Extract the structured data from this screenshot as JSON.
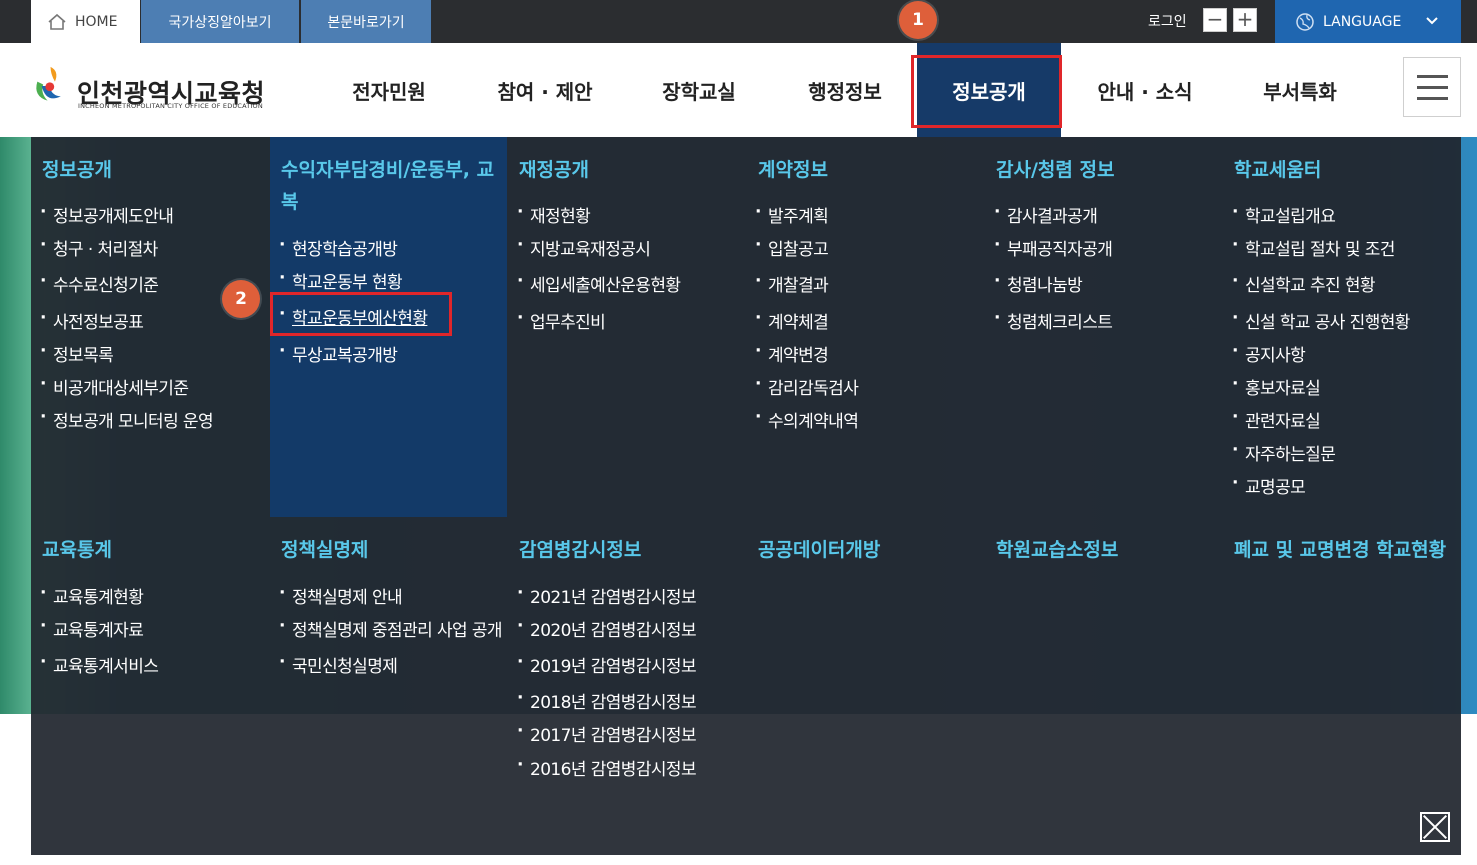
{
  "topbar": {
    "home": "HOME",
    "util_links": [
      "국가상징알아보기",
      "본문바로가기"
    ],
    "login": "로그인",
    "zoom_out": "−",
    "zoom_in": "+",
    "language": "LANGUAGE"
  },
  "logo": {
    "name": "인천광역시교육청",
    "sub": "INCHEON METROPOLITAN CITY OFFICE OF EDUCATION"
  },
  "gnb": [
    {
      "label": "전자민원"
    },
    {
      "label": "참여 · 제안"
    },
    {
      "label": "장학교실"
    },
    {
      "label": "행정정보"
    },
    {
      "label": "정보공개",
      "active": true
    },
    {
      "label": "안내 · 소식"
    },
    {
      "label": "부서특화"
    }
  ],
  "badges": [
    "1",
    "2"
  ],
  "mega_menu": {
    "row1": [
      {
        "title": "정보공개",
        "items": [
          "정보공개제도안내",
          "청구 · 처리절차",
          "수수료신청기준",
          "사전정보공표",
          "정보목록",
          "비공개대상세부기준",
          "정보공개 모니터링 운영"
        ]
      },
      {
        "title": "수익자부담경비/운동부, 교복",
        "items": [
          "현장학습공개방",
          "학교운동부 현황",
          "학교운동부예산현황",
          "무상교복공개방"
        ]
      },
      {
        "title": "재정공개",
        "items": [
          "재정현황",
          "지방교육재정공시",
          "세입세출예산운용현황",
          "업무추진비"
        ]
      },
      {
        "title": "계약정보",
        "items": [
          "발주계획",
          "입찰공고",
          "개찰결과",
          "계약체결",
          "계약변경",
          "감리감독검사",
          "수의계약내역"
        ]
      },
      {
        "title": "감사/청렴 정보",
        "items": [
          "감사결과공개",
          "부패공직자공개",
          "청렴나눔방",
          "청렴체크리스트"
        ]
      },
      {
        "title": "학교세움터",
        "items": [
          "학교설립개요",
          "학교설립 절차 및 조건",
          "신설학교 추진 현황",
          "신설 학교 공사 진행현황",
          "공지사항",
          "홍보자료실",
          "관련자료실",
          "자주하는질문",
          "교명공모"
        ]
      }
    ],
    "row2": [
      {
        "title": "교육통계",
        "items": [
          "교육통계현황",
          "교육통계자료",
          "교육통계서비스"
        ]
      },
      {
        "title": "정책실명제",
        "items": [
          "정책실명제 안내",
          "정책실명제 중점관리 사업 공개",
          "국민신청실명제"
        ]
      },
      {
        "title": "감염병감시정보",
        "items": [
          "2021년 감염병감시정보",
          "2020년 감염병감시정보",
          "2019년 감염병감시정보",
          "2018년 감염병감시정보",
          "2017년 감염병감시정보",
          "2016년 감염병감시정보"
        ]
      },
      {
        "title": "공공데이터개방",
        "items": []
      },
      {
        "title": "학원교습소정보",
        "items": []
      },
      {
        "title": "폐교 및 교명변경 학교현황",
        "items": []
      }
    ]
  }
}
